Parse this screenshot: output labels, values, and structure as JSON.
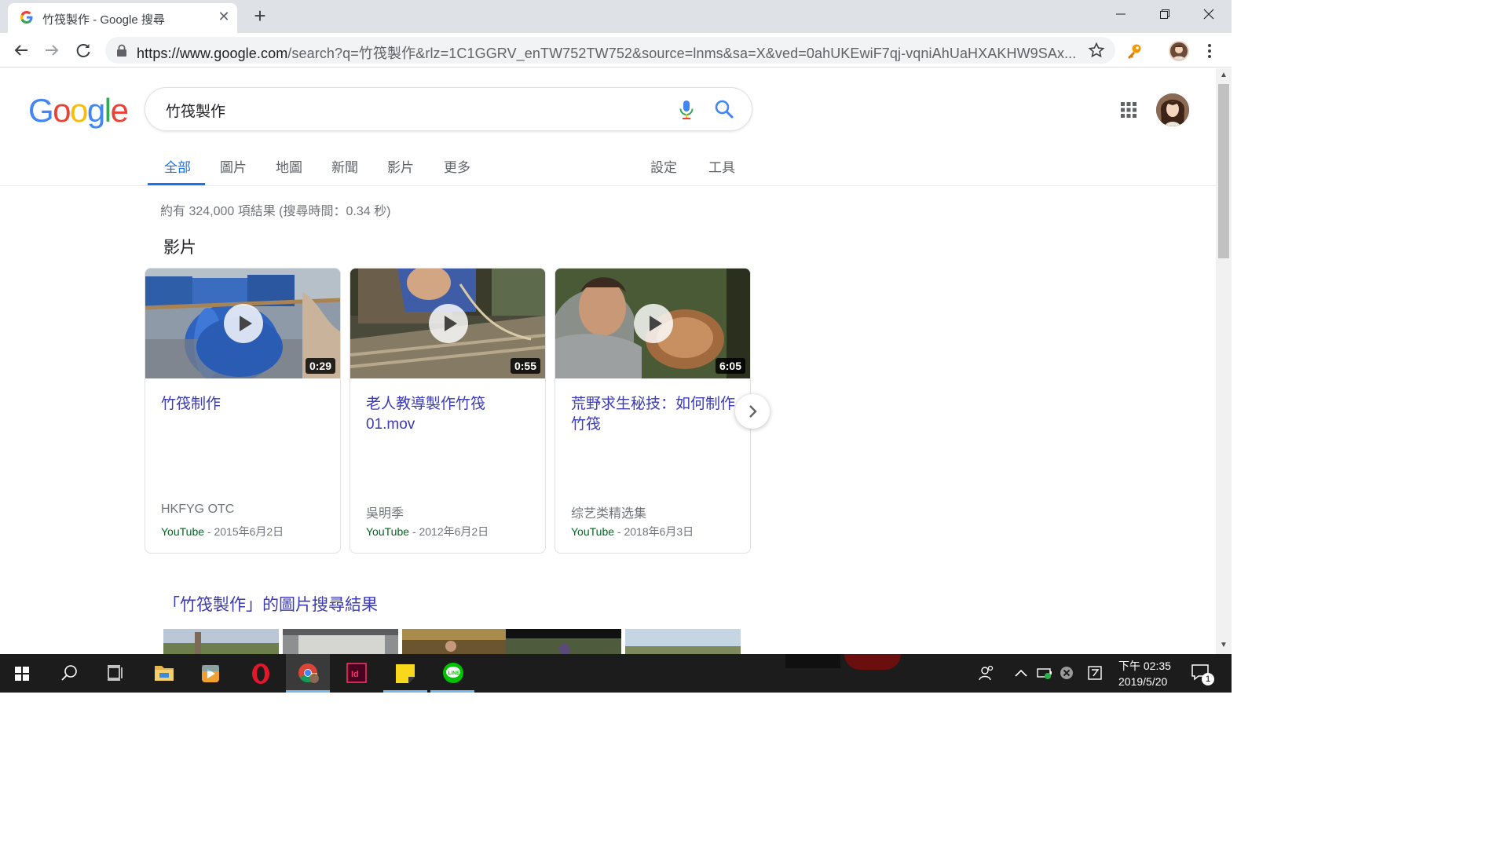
{
  "browser": {
    "tab_title": "竹筏製作 - Google 搜尋",
    "url_scheme_host": "https://www.google.com",
    "url_rest": "/search?q=竹筏製作&rlz=1C1GGRV_enTW752TW752&source=lnms&sa=X&ved=0ahUKEwiF7qj-vqniAhUaHXAKHW9SAx..."
  },
  "search": {
    "query": "竹筏製作"
  },
  "nav_tabs": {
    "all": "全部",
    "images": "圖片",
    "maps": "地圖",
    "news": "新聞",
    "videos": "影片",
    "more": "更多",
    "settings": "設定",
    "tools": "工具"
  },
  "results": {
    "stats": "約有 324,000 項結果 (搜尋時間：0.34 秒)",
    "videos_heading": "影片",
    "videos": [
      {
        "title": "竹筏制作",
        "duration": "0:29",
        "channel": "HKFYG OTC",
        "source": "YouTube",
        "date": " - 2015年6月2日"
      },
      {
        "title": "老人教導製作竹筏 01.mov",
        "duration": "0:55",
        "channel": "吳明季",
        "source": "YouTube",
        "date": " - 2012年6月2日"
      },
      {
        "title": "荒野求生秘技：如何制作竹筏",
        "duration": "6:05",
        "channel": "综艺类精选集",
        "source": "YouTube",
        "date": " - 2018年6月3日"
      }
    ],
    "images_heading": "「竹筏製作」的圖片搜尋結果"
  },
  "taskbar": {
    "time": "下午 02:35",
    "date": "2019/5/20",
    "notifications": "1"
  },
  "colors": {
    "google_blue": "#4285F4",
    "google_red": "#EA4335",
    "google_yellow": "#FBBC05",
    "google_green": "#34A853",
    "link": "#3c3bb5",
    "active_tab": "#1a73e8"
  },
  "icons": [
    "google-favicon-icon",
    "close-icon",
    "plus-icon",
    "minimize-icon",
    "restore-icon",
    "back-icon",
    "forward-icon",
    "reload-icon",
    "lock-icon",
    "star-icon",
    "key-extension-icon",
    "profile-avatar",
    "menu-dots-icon",
    "mic-icon",
    "search-icon",
    "apps-grid-icon",
    "play-icon",
    "chevron-right-icon",
    "windows-start-icon",
    "taskbar-search-icon",
    "task-view-icon",
    "file-explorer-icon",
    "media-player-icon",
    "opera-icon",
    "chrome-icon",
    "indesign-icon",
    "sticky-notes-icon",
    "line-icon",
    "people-icon",
    "chevron-up-icon",
    "battery-icon",
    "notifications-icon"
  ]
}
